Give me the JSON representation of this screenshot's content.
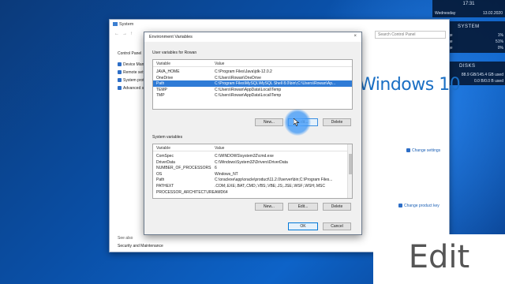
{
  "widgets": {
    "clock": {
      "time": "17:31",
      "day": "Wednesday",
      "date": "13.02.2020"
    },
    "system": {
      "header": "SYSTEM",
      "rows": [
        {
          "label": "ge",
          "value": "1%"
        },
        {
          "label": "ge",
          "value": "51%"
        },
        {
          "label": "ge",
          "value": "0%"
        }
      ]
    },
    "disks": {
      "header": "DISKS",
      "row1": "88.9 GB/145.4 GB used",
      "row2": "0.0 B/0.0 B used"
    }
  },
  "system_window": {
    "title": "System",
    "search_placeholder": "Search Control Panel",
    "control_panel_home": "Control Panel",
    "left_items": [
      "Device Manag",
      "Remote settin",
      "System protect",
      "Advanced syst"
    ],
    "windows_logo_text": "Windows 10",
    "change_settings": "Change settings",
    "change_product_key": "Change product key",
    "see_also": "See also",
    "security_maintenance": "Security and Maintenance"
  },
  "env_dialog": {
    "title": "Environment Variables",
    "close": "×",
    "user_label": "User variables for Rowan",
    "system_label": "System variables",
    "col_variable": "Variable",
    "col_value": "Value",
    "user_vars": [
      {
        "name": "JAVA_HOME",
        "value": "C:\\Program Files\\Java\\jdk-12.0.2"
      },
      {
        "name": "OneDrive",
        "value": "C:\\Users\\Rowan\\OneDrive"
      },
      {
        "name": "Path",
        "value": "C:\\Program Files\\MySQL\\MySQL Shell 8.0\\bin\\;C:\\Users\\Rowan\\Ap..."
      },
      {
        "name": "TEMP",
        "value": "C:\\Users\\Rowan\\AppData\\Local\\Temp"
      },
      {
        "name": "TMP",
        "value": "C:\\Users\\Rowan\\AppData\\Local\\Temp"
      }
    ],
    "system_vars": [
      {
        "name": "ComSpec",
        "value": "C:\\WINDOWS\\system32\\cmd.exe"
      },
      {
        "name": "DriverData",
        "value": "C:\\Windows\\System32\\Drivers\\DriverData"
      },
      {
        "name": "NUMBER_OF_PROCESSORS",
        "value": "6"
      },
      {
        "name": "OS",
        "value": "Windows_NT"
      },
      {
        "name": "Path",
        "value": "C:\\oraclexe\\app\\oracle\\product\\11.2.0\\server\\bin;C:\\Program Files..."
      },
      {
        "name": "PATHEXT",
        "value": ".COM;.EXE;.BAT;.CMD;.VBS;.VBE;.JS;.JSE;.WSF;.WSH;.MSC"
      },
      {
        "name": "PROCESSOR_ARCHITECTURE",
        "value": "AMD64"
      }
    ],
    "buttons": {
      "new": "New...",
      "edit": "Edit...",
      "delete": "Delete",
      "ok": "OK",
      "cancel": "Cancel"
    }
  },
  "caption": "Edit"
}
